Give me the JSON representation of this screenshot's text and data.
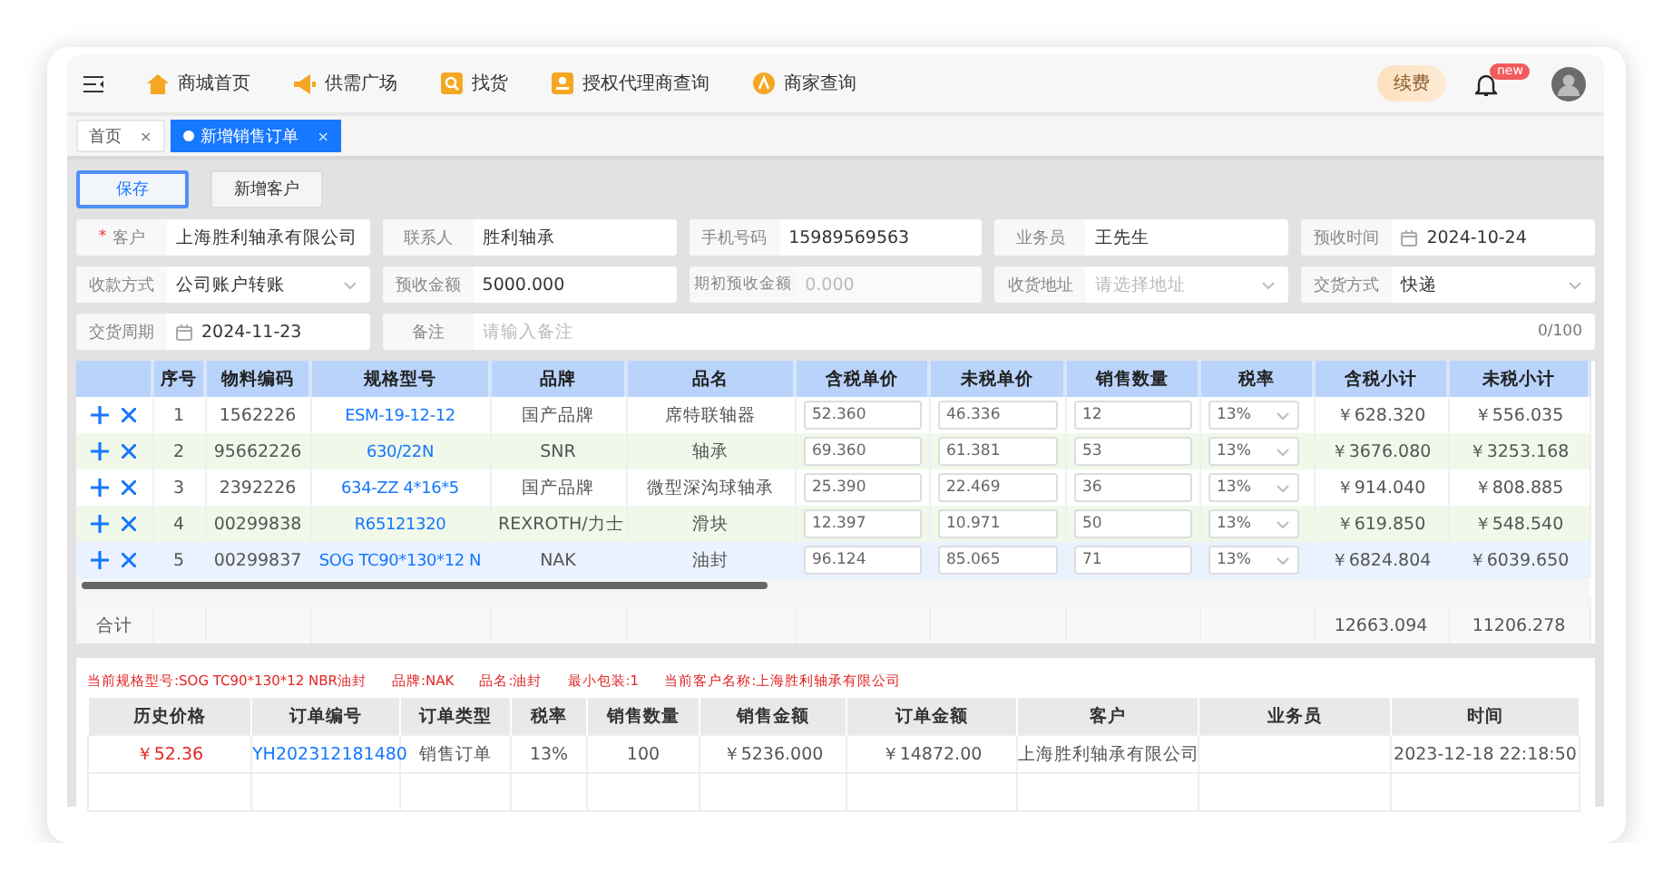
{
  "nav": {
    "items": [
      {
        "label": "商城首页"
      },
      {
        "label": "供需广场"
      },
      {
        "label": "找货"
      },
      {
        "label": "授权代理商查询"
      },
      {
        "label": "商家查询"
      }
    ],
    "renew": "续费",
    "badge": "new"
  },
  "tabs": [
    {
      "label": "首页",
      "close": "×",
      "selected": false
    },
    {
      "label": "新增销售订单",
      "close": "×",
      "selected": true
    }
  ],
  "buttons": [
    {
      "label": "保存",
      "kind": "primary"
    },
    {
      "label": "新增客户",
      "kind": "default"
    }
  ],
  "form": [
    {
      "label": "客户",
      "required_mark": "*",
      "kind": "text",
      "value": "上海胜利轴承有限公司"
    },
    {
      "label": "联系人",
      "kind": "text",
      "value": "胜利轴承"
    },
    {
      "label": "手机号码",
      "kind": "text",
      "value": "15989569563"
    },
    {
      "label": "业务员",
      "kind": "text",
      "value": "王先生"
    },
    {
      "label": "预收时间",
      "kind": "date",
      "value": "2024-10-24"
    },
    {
      "label": "收款方式",
      "kind": "select",
      "value": "公司账户转账"
    },
    {
      "label": "预收金额",
      "kind": "text",
      "value": "5000.000"
    },
    {
      "label": "期初预收金额",
      "kind": "text",
      "value": "0.000",
      "disabled": true
    },
    {
      "label": "收货地址",
      "kind": "select",
      "placeholder": "请选择地址"
    },
    {
      "label": "交货方式",
      "kind": "select",
      "value": "快递"
    },
    {
      "label": "交货周期",
      "kind": "date",
      "value": "2024-11-23"
    },
    {
      "label": "备注",
      "kind": "textarea",
      "placeholder": "请输入备注",
      "counter": "0/100"
    }
  ],
  "table": {
    "columns": [
      "序号",
      "物料编码",
      "规格型号",
      "品牌",
      "品名",
      "含税单价",
      "未税单价",
      "销售数量",
      "税率",
      "含税小计",
      "未税小计"
    ],
    "rows": [
      {
        "seq": "1",
        "code": "1562226",
        "spec": "ESM-19-12-12",
        "brand": "国产品牌",
        "name": "席特联轴器",
        "tax_price": "52.360",
        "net_price": "46.336",
        "qty": "12",
        "tax_rate": "13%",
        "tax_subtotal": "￥628.320",
        "net_subtotal": "￥556.035",
        "selected": false
      },
      {
        "seq": "2",
        "code": "95662226",
        "spec": "630/22N",
        "brand": "SNR",
        "name": "轴承",
        "tax_price": "69.360",
        "net_price": "61.381",
        "qty": "53",
        "tax_rate": "13%",
        "tax_subtotal": "￥3676.080",
        "net_subtotal": "￥3253.168",
        "selected": false
      },
      {
        "seq": "3",
        "code": "2392226",
        "spec": "634-ZZ 4*16*5",
        "brand": "国产品牌",
        "name": "微型深沟球轴承",
        "tax_price": "25.390",
        "net_price": "22.469",
        "qty": "36",
        "tax_rate": "13%",
        "tax_subtotal": "￥914.040",
        "net_subtotal": "￥808.885",
        "selected": false
      },
      {
        "seq": "4",
        "code": "00299838",
        "spec": "R65121320",
        "brand": "REXROTH/力士",
        "name": "滑块",
        "tax_price": "12.397",
        "net_price": "10.971",
        "qty": "50",
        "tax_rate": "13%",
        "tax_subtotal": "￥619.850",
        "net_subtotal": "￥548.540",
        "selected": false
      },
      {
        "seq": "5",
        "code": "00299837",
        "spec": "SOG TC90*130*12 N",
        "brand": "NAK",
        "name": "油封",
        "tax_price": "96.124",
        "net_price": "85.065",
        "qty": "71",
        "tax_rate": "13%",
        "tax_subtotal": "￥6824.804",
        "net_subtotal": "￥6039.650",
        "selected": true
      }
    ],
    "total": {
      "label": "合计",
      "tax_total": "12663.094",
      "net_total": "11206.278"
    }
  },
  "info": [
    "当前规格型号:SOG TC90*130*12 NBR油封",
    "品牌:NAK",
    "品名:油封",
    "最小包装:1",
    "当前客户名称:上海胜利轴承有限公司"
  ],
  "history": {
    "columns": [
      "历史价格",
      "订单编号",
      "订单类型",
      "税率",
      "销售数量",
      "销售金额",
      "订单金额",
      "客户",
      "业务员",
      "时间"
    ],
    "rows": [
      {
        "price": "￥52.36",
        "order_no": "YH202312181480",
        "type": "销售订单",
        "tax_rate": "13%",
        "qty": "100",
        "sales_amount": "￥5236.000",
        "order_amount": "￥14872.00",
        "customer": "上海胜利轴承有限公司",
        "time": "2023-12-18 22:18:50"
      }
    ]
  }
}
